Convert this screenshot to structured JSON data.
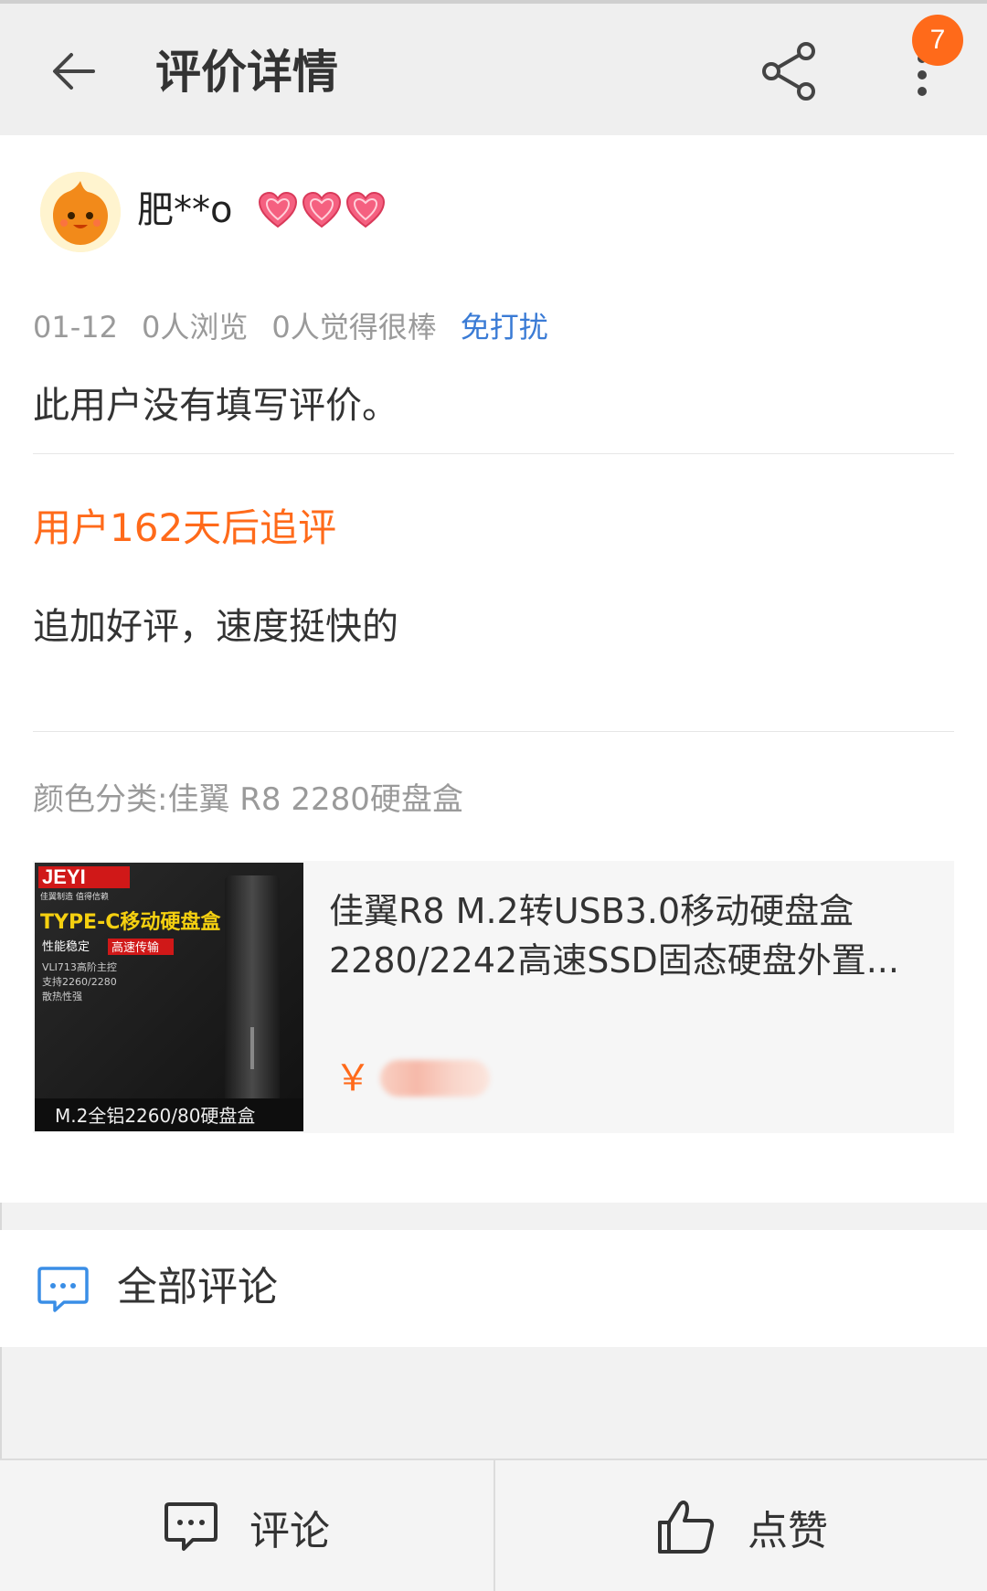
{
  "header": {
    "title": "评价详情",
    "badge_count": "7",
    "icons": {
      "back": "back-arrow-icon",
      "share": "share-icon",
      "more": "more-vertical-icon"
    }
  },
  "review": {
    "username": "肥**o",
    "level_icon": "heart-level-icon",
    "date": "01-12",
    "views": "0人浏览",
    "likes": "0人觉得很棒",
    "do_not_disturb": "免打扰",
    "text": "此用户没有填写评价。"
  },
  "followup": {
    "title": "用户162天后追评",
    "text": "追加好评，速度挺快的"
  },
  "sku": "颜色分类:佳翼 R8 2280硬盘盒",
  "product": {
    "title": "佳翼R8 M.2转USB3.0移动硬盘盒2280/2242高速SSD固态硬盘外置...",
    "currency": "￥",
    "image_text": {
      "brand": "JEYI",
      "tagline": "佳翼制造 值得信赖",
      "headline": "TYPE-C移动硬盘盒",
      "feature1": "性能稳定",
      "feature2": "高速传输",
      "spec1": "VLI713高阶主控",
      "spec2": "支持2260/2280",
      "spec3": "散热性强",
      "caption": "M.2全铝2260/80硬盘盒"
    }
  },
  "comments_entry": {
    "label": "全部评论"
  },
  "bottom_bar": {
    "comment_label": "评论",
    "like_label": "点赞"
  },
  "colors": {
    "accent": "#ff6a1a",
    "link": "#3a7bd5"
  }
}
